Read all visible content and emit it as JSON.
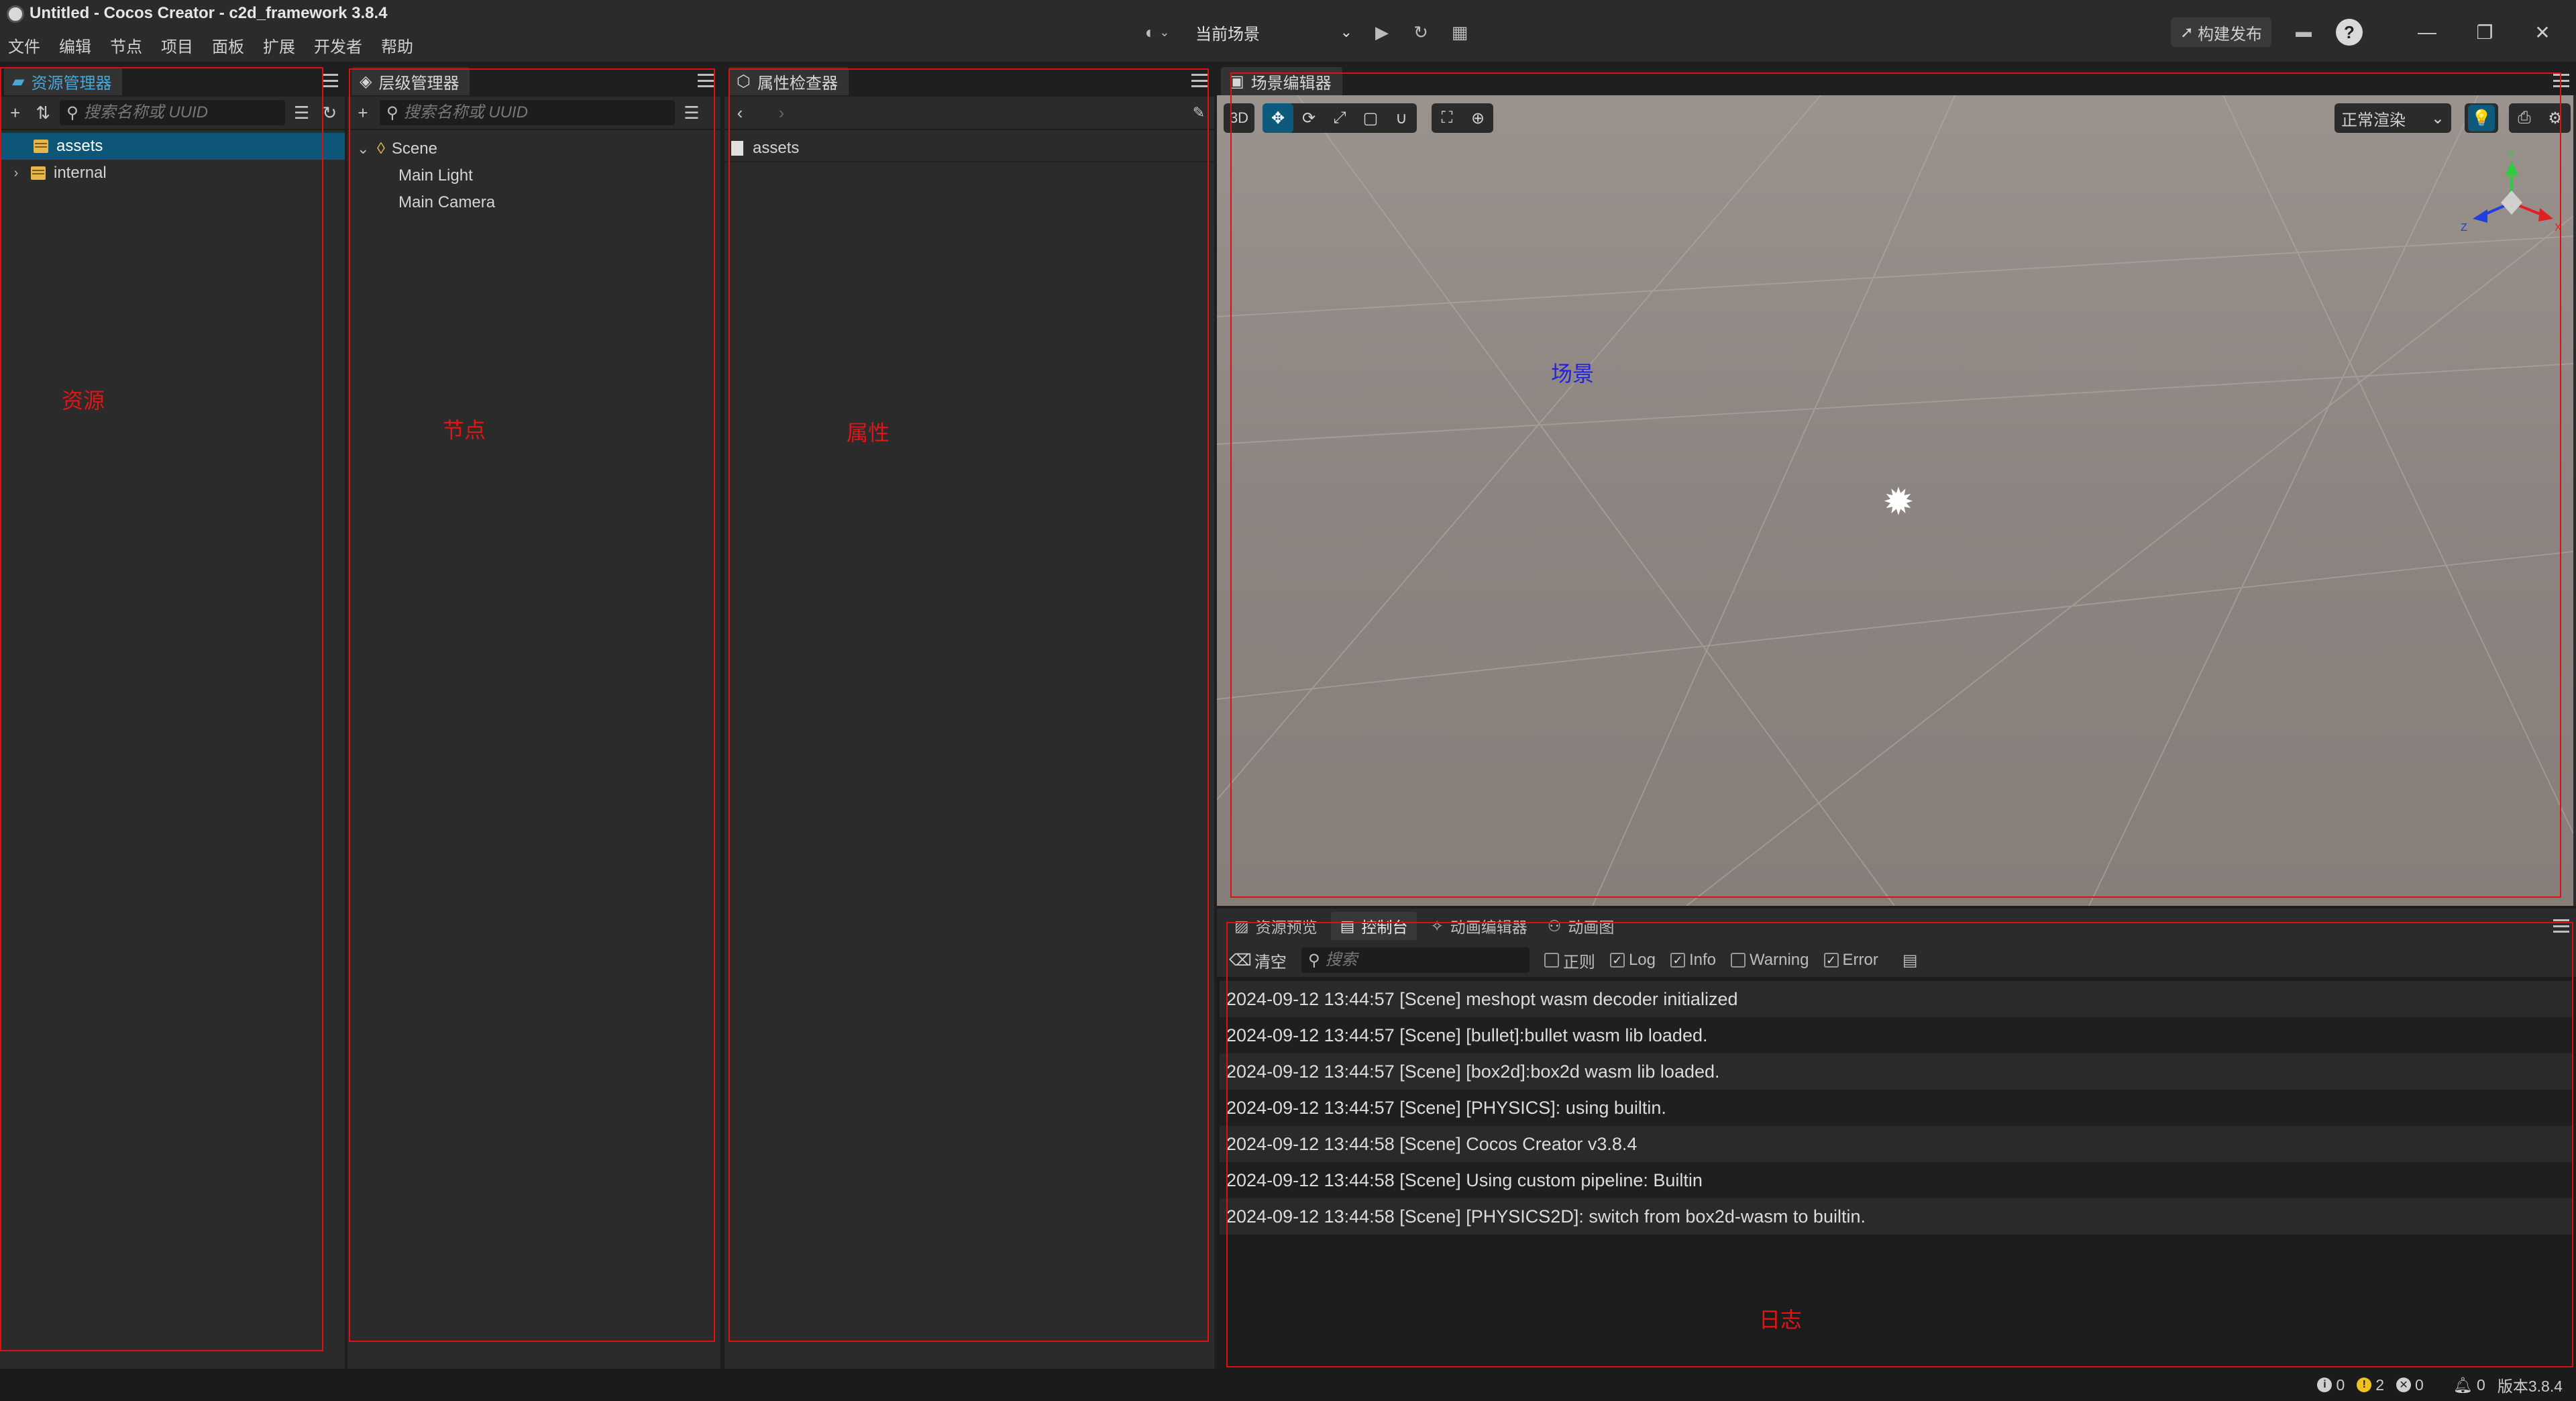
{
  "window": {
    "title": "Untitled - Cocos Creator - c2d_framework 3.8.4"
  },
  "menu": [
    "文件",
    "编辑",
    "节点",
    "项目",
    "面板",
    "扩展",
    "开发者",
    "帮助"
  ],
  "toolbar": {
    "scene_select": "当前场景",
    "build_label": "构建发布"
  },
  "assets_panel": {
    "tab": "资源管理器",
    "search_placeholder": "搜索名称或 UUID",
    "items": [
      {
        "label": "assets",
        "selected": true
      },
      {
        "label": "internal",
        "selected": false
      }
    ],
    "annotation": "资源"
  },
  "hierarchy_panel": {
    "tab": "层级管理器",
    "search_placeholder": "搜索名称或 UUID",
    "root": "Scene",
    "children": [
      "Main Light",
      "Main Camera"
    ],
    "annotation": "节点"
  },
  "inspector_panel": {
    "tab": "属性检查器",
    "item": "assets",
    "annotation": "属性"
  },
  "scene_panel": {
    "tab": "场景编辑器",
    "mode_3d": "3D",
    "render_mode": "正常渲染",
    "annotation": "场景",
    "gizmo_axes": {
      "x": "X",
      "y": "Y",
      "z": "Z"
    }
  },
  "bottom_panel": {
    "tabs": [
      "资源预览",
      "控制台",
      "动画编辑器",
      "动画图"
    ],
    "active_tab": "控制台",
    "clear_label": "清空",
    "search_placeholder": "搜索",
    "filters": [
      {
        "label": "正则",
        "checked": false
      },
      {
        "label": "Log",
        "checked": true
      },
      {
        "label": "Info",
        "checked": true
      },
      {
        "label": "Warning",
        "checked": false
      },
      {
        "label": "Error",
        "checked": true
      }
    ],
    "logs": [
      "2024-09-12 13:44:57 [Scene] meshopt wasm decoder initialized",
      "2024-09-12 13:44:57 [Scene] [bullet]:bullet wasm lib loaded.",
      "2024-09-12 13:44:57 [Scene] [box2d]:box2d wasm lib loaded.",
      "2024-09-12 13:44:57 [Scene] [PHYSICS]: using builtin.",
      "2024-09-12 13:44:58 [Scene] Cocos Creator v3.8.4",
      "2024-09-12 13:44:58 [Scene] Using custom pipeline: Builtin",
      "2024-09-12 13:44:58 [Scene] [PHYSICS2D]: switch from box2d-wasm to builtin."
    ],
    "annotation": "日志"
  },
  "statusbar": {
    "info_count": "0",
    "warning_count": "2",
    "error_count": "0",
    "notify_count": "0",
    "version": "版本3.8.4"
  },
  "colors": {
    "accent": "#0e5678",
    "annotation_red": "#e01616",
    "annotation_blue": "#2222dd"
  }
}
